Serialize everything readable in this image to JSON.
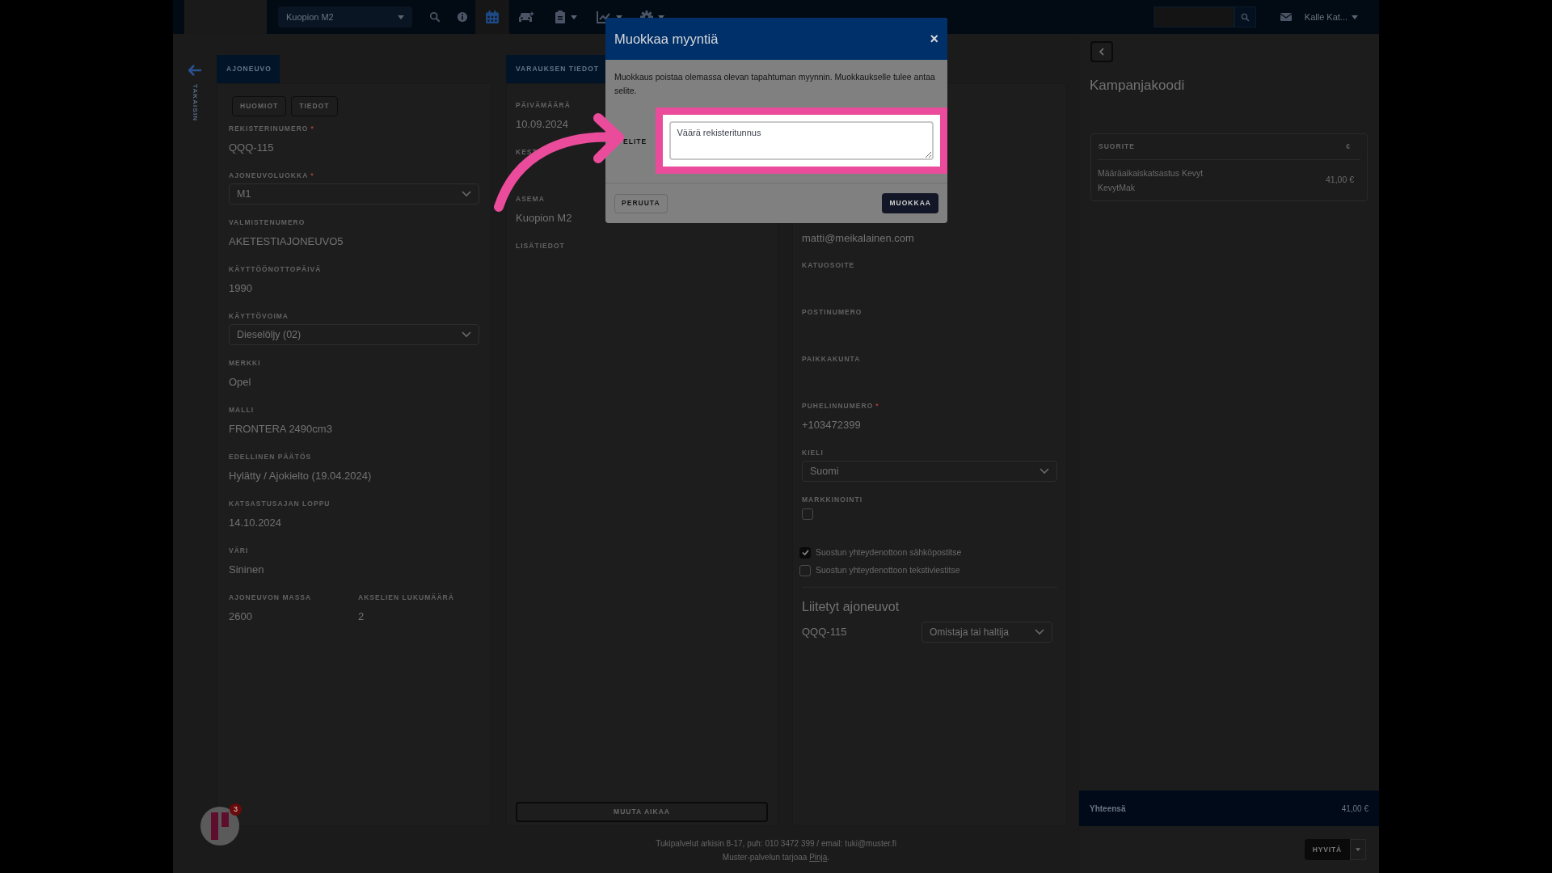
{
  "nav": {
    "station": "Kuopion M2",
    "user": "Kalle Kat...",
    "tools": [
      {
        "selected": false,
        "has_menu": false
      },
      {
        "selected": false,
        "has_menu": false
      },
      {
        "selected": true,
        "has_menu": false
      },
      {
        "selected": false,
        "has_menu": false
      },
      {
        "selected": false,
        "has_menu": true
      },
      {
        "selected": false,
        "has_menu": true
      },
      {
        "selected": false,
        "has_menu": true
      }
    ]
  },
  "back_label": "TAKAISIN",
  "vehicle": {
    "tab": "AJONEUVO",
    "buttons": [
      "HUOMIOT",
      "TIEDOT"
    ],
    "fields": [
      {
        "kind": "text",
        "label": "REKISTERINUMERO",
        "required_mark": "*",
        "value": "QQQ-115"
      },
      {
        "kind": "select",
        "label": "AJONEUVOLUOKKA",
        "required_mark": "*",
        "value": "M1"
      },
      {
        "kind": "text",
        "label": "VALMISTENUMERO",
        "value": "AKETESTIAJONEUVO5"
      },
      {
        "kind": "text",
        "label": "KÄYTTÖÖNOTTOPÄIVÄ",
        "value": "1990"
      },
      {
        "kind": "select",
        "label": "KÄYTTÖVOIMA",
        "value": "Dieselöljy (02)"
      },
      {
        "kind": "text",
        "label": "MERKKI",
        "value": "Opel"
      },
      {
        "kind": "text",
        "label": "MALLI",
        "value": "FRONTERA 2490cm3"
      },
      {
        "kind": "text",
        "label": "EDELLINEN PÄÄTÖS",
        "value": "Hylätty / Ajokielto (19.04.2024)"
      },
      {
        "kind": "text",
        "label": "KATSASTUSAJAN LOPPU",
        "value": "14.10.2024"
      },
      {
        "kind": "text",
        "label": "VÄRI",
        "value": "Sininen"
      },
      {
        "kind": "pair",
        "fields": [
          {
            "kind": "text",
            "label": "AJONEUVON MASSA",
            "value": "2600"
          },
          {
            "kind": "text",
            "label": "AKSELIEN LUKUMÄÄRÄ",
            "value": "2"
          }
        ]
      }
    ]
  },
  "reservation": {
    "tab": "VARAUKSEN TIEDOT",
    "fields": [
      {
        "kind": "text",
        "label": "PÄIVÄMÄÄRÄ",
        "value": "10.09.2024"
      },
      {
        "kind": "text",
        "label": "KEST"
      },
      {
        "kind": "text",
        "label": "ASEMA",
        "value": "Kuopion M2"
      },
      {
        "kind": "text",
        "label": "LISÄTIEDOT"
      }
    ],
    "button": "MUUTA AIKAA"
  },
  "customer": {
    "email": "matti@meikalainen.com",
    "fields": [
      {
        "kind": "text",
        "label": "KATUOSOITE"
      },
      {
        "kind": "text",
        "label": "POSTINUMERO"
      },
      {
        "kind": "text",
        "label": "PAIKKAKUNTA"
      },
      {
        "kind": "text",
        "label": "PUHELINNUMERO",
        "required_mark": "*",
        "value": "+103472399"
      },
      {
        "kind": "select",
        "label": "KIELI",
        "value": "Suomi"
      },
      {
        "kind": "checkbox",
        "label": "MARKKINOINTI",
        "checked": false
      }
    ],
    "consents": [
      {
        "label": "Suostun yhteydenottoon sähköpostitse",
        "checked": true
      },
      {
        "label": "Suostun yhteydenottoon tekstiviestitse",
        "checked": false
      }
    ],
    "linked_title": "Liitetyt ajoneuvot",
    "linked": [
      {
        "plate": "QQQ-115",
        "role": "Omistaja tai haltija"
      }
    ]
  },
  "sidebar": {
    "title": "Kampanjakoodi",
    "columns": [
      "SUORITE",
      "€"
    ],
    "rows": [
      {
        "item": "Määräaikaiskatsastus Kevyt KevytMak",
        "price": "41,00 €"
      }
    ],
    "total_label": "Yhteensä",
    "total": "41,00 €",
    "refund_button": "HYVITÄ"
  },
  "footer": {
    "support": "Tukipalvelut arkisin 8-17, puh: 010 3472 399 / email: tuki@muster.fi",
    "provider_prefix": "Muster-palvelun tarjoaa ",
    "provider_link": "Pinja",
    "provider_suffix": "."
  },
  "chat": {
    "badge": "3"
  },
  "modal": {
    "title": "Muokkaa myyntiä",
    "close": "×",
    "message": "Muokkaus poistaa olemassa olevan tapahtuman myynnin. Muokkaukselle tulee antaa selite.",
    "field_label": "ELITE",
    "field_value": "Väärä rekisteritunnus",
    "cancel": "PERUUTA",
    "confirm": "MUOKKAA"
  }
}
